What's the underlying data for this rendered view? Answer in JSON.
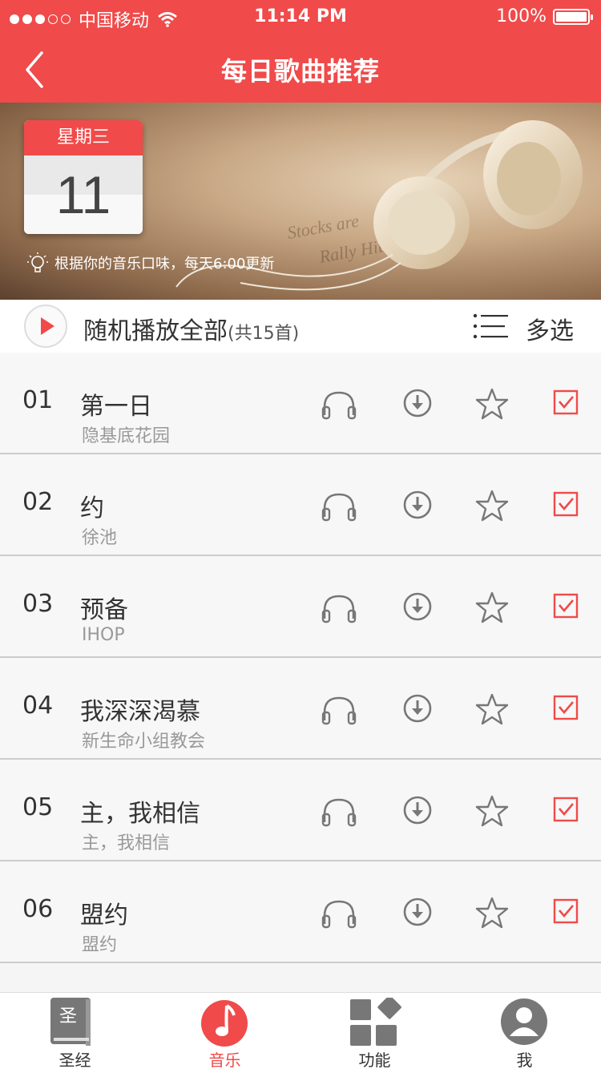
{
  "status_bar": {
    "carrier": "中国移动",
    "time": "11:14 PM",
    "battery": "100%"
  },
  "header": {
    "title": "每日歌曲推荐"
  },
  "banner": {
    "weekday": "星期三",
    "day": "11",
    "tip": "根据你的音乐口味，每天6:00更新"
  },
  "actions": {
    "play_all": "随机播放全部",
    "count": "(共15首)",
    "multi_select": "多选"
  },
  "songs": [
    {
      "num": "01",
      "title": "第一日",
      "artist": "隐基底花园"
    },
    {
      "num": "02",
      "title": "约",
      "artist": "徐池"
    },
    {
      "num": "03",
      "title": "预备",
      "artist": "IHOP"
    },
    {
      "num": "04",
      "title": "我深深渴慕",
      "artist": "新生命小组教会"
    },
    {
      "num": "05",
      "title": "主，我相信",
      "artist": "主，我相信"
    },
    {
      "num": "06",
      "title": "盟约",
      "artist": "盟约"
    }
  ],
  "tabs": [
    {
      "label": "圣经",
      "icon": "bible-icon",
      "book_char": "圣"
    },
    {
      "label": "音乐",
      "icon": "music-note-icon",
      "active": true
    },
    {
      "label": "功能",
      "icon": "grid-icon"
    },
    {
      "label": "我",
      "icon": "user-icon"
    }
  ],
  "colors": {
    "accent": "#f04a4a",
    "icon_gray": "#777777"
  }
}
